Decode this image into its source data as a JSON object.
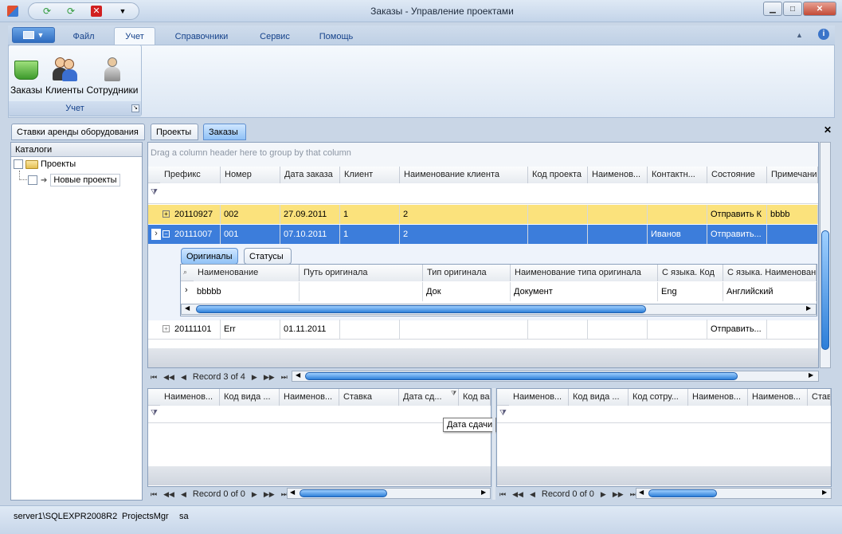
{
  "window": {
    "title": "Заказы - Управление проектами"
  },
  "ribbon": {
    "tabs": [
      "Файл",
      "Учет",
      "Справочники",
      "Сервис",
      "Помощь"
    ],
    "active_tab": "Учет",
    "group_title": "Учет",
    "buttons": [
      "Заказы",
      "Клиенты",
      "Сотрудники"
    ]
  },
  "doc_tabs": [
    "Ставки аренды оборудования",
    "Проекты",
    "Заказы"
  ],
  "left_pane": {
    "title": "Каталоги",
    "tree": [
      "Проекты",
      "Новые проекты"
    ]
  },
  "main_grid": {
    "group_hint": "Drag a column header here to group by that column",
    "columns": [
      "Префикс",
      "Номер",
      "Дата заказа",
      "Клиент",
      "Наименование клиента",
      "Код проекта",
      "Наименов...",
      "Контактн...",
      "Состояние",
      "Примечание"
    ],
    "rows": [
      [
        "20110927",
        "002",
        "27.09.2011",
        "1",
        "2",
        "",
        "",
        "",
        "Отправить К",
        "bbbb"
      ],
      [
        "20111007",
        "001",
        "07.10.2011",
        "1",
        "2",
        "",
        "",
        "Иванов",
        "Отправить...",
        ""
      ],
      [
        "20111101",
        "Err",
        "01.11.2011",
        "",
        "",
        "",
        "",
        "",
        "Отправить...",
        ""
      ]
    ],
    "detail_tabs": [
      "Оригиналы",
      "Статусы"
    ],
    "detail_columns": [
      "Наименование",
      "Путь оригинала",
      "Тип оригинала",
      "Наименование типа оригинала",
      "С языка. Код",
      "С языка. Наименование"
    ],
    "detail_row": [
      "bbbbb",
      "",
      "Док",
      "Документ",
      "Eng",
      "Английский"
    ],
    "record_text": "Record 3 of 4"
  },
  "bottom_left": {
    "columns": [
      "Наименов...",
      "Код вида ...",
      "Наименов...",
      "Ставка",
      "Дата сд...",
      "Код ва"
    ],
    "record_text": "Record 0 of 0",
    "tooltip": "Дата сдачи"
  },
  "bottom_right": {
    "columns": [
      "Наименов...",
      "Код вида ...",
      "Код сотру...",
      "Наименов...",
      "Наименов...",
      "Став"
    ],
    "record_text": "Record 0 of 0"
  },
  "status": {
    "server": "server1\\SQLEXPR2008R2",
    "db": "ProjectsMgr",
    "user": "sa"
  },
  "colors": {
    "selected_row": "#3c7ddb",
    "highlight_row": "#fbe27c",
    "accent": "#15428b"
  }
}
